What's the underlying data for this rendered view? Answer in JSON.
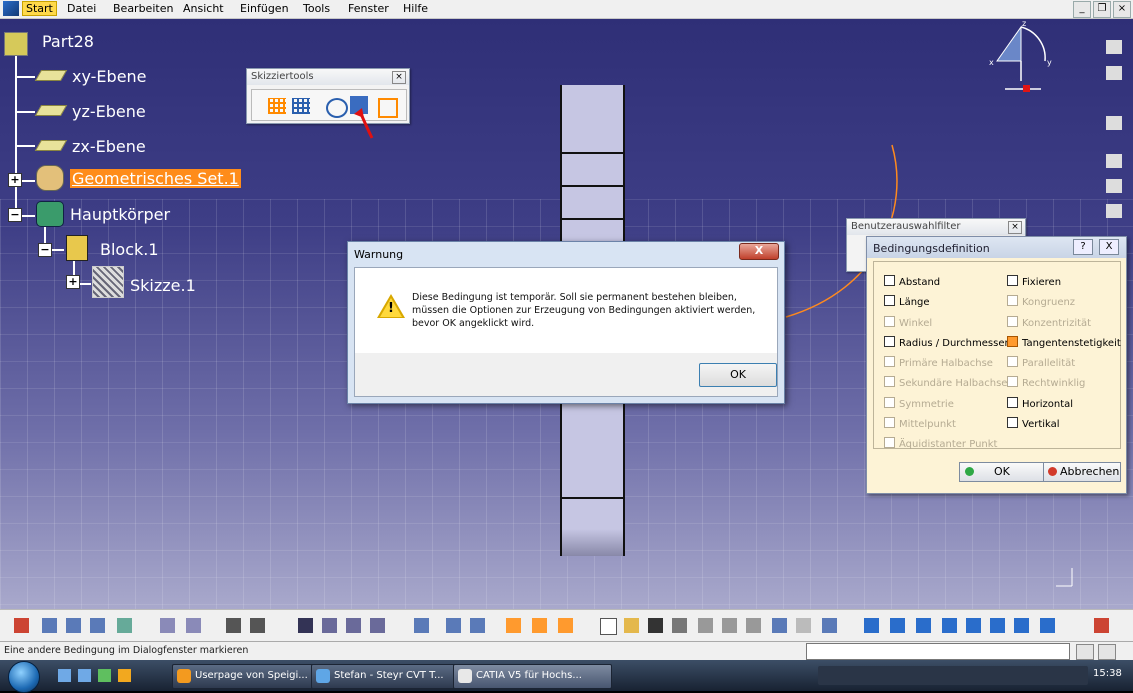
{
  "menubar": {
    "items": [
      "Start",
      "Datei",
      "Bearbeiten",
      "Ansicht",
      "Einfügen",
      "Tools",
      "Fenster",
      "Hilfe"
    ],
    "active": "Start"
  },
  "tree": {
    "root": "Part28",
    "nodes": [
      "xy-Ebene",
      "yz-Ebene",
      "zx-Ebene",
      "Geometrisches Set.1",
      "Hauptkörper",
      "Block.1",
      "Skizze.1"
    ]
  },
  "skizziertools": {
    "title": "Skizziertools"
  },
  "benutzerfilter": {
    "title": "Benutzerauswahlfilter"
  },
  "warning": {
    "title": "Warnung",
    "close": "X",
    "message_lines": [
      "Diese Bedingung ist temporär. Soll sie permanent bestehen bleiben,",
      "müssen die Optionen zur Erzeugung von Bedingungen aktiviert werden,",
      "bevor OK angeklickt wird."
    ],
    "ok": "OK"
  },
  "bedingungsdefinition": {
    "title": "Bedingungsdefinition",
    "help": "?",
    "close": "X",
    "left": [
      {
        "label": "Abstand",
        "enabled": true,
        "checked": false
      },
      {
        "label": "Länge",
        "enabled": true,
        "checked": false
      },
      {
        "label": "Winkel",
        "enabled": false,
        "checked": false
      },
      {
        "label": "Radius / Durchmesser",
        "enabled": true,
        "checked": false
      },
      {
        "label": "Primäre Halbachse",
        "enabled": false,
        "checked": false
      },
      {
        "label": "Sekundäre Halbachse",
        "enabled": false,
        "checked": false
      },
      {
        "label": "Symmetrie",
        "enabled": false,
        "checked": false
      },
      {
        "label": "Mittelpunkt",
        "enabled": false,
        "checked": false
      },
      {
        "label": "Äquidistanter Punkt",
        "enabled": false,
        "checked": false
      }
    ],
    "right": [
      {
        "label": "Fixieren",
        "enabled": true,
        "checked": false
      },
      {
        "label": "Kongruenz",
        "enabled": false,
        "checked": false
      },
      {
        "label": "Konzentrizität",
        "enabled": false,
        "checked": false
      },
      {
        "label": "Tangentenstetigkeit",
        "enabled": true,
        "checked": true
      },
      {
        "label": "Parallelität",
        "enabled": false,
        "checked": false
      },
      {
        "label": "Rechtwinklig",
        "enabled": false,
        "checked": false
      },
      {
        "label": "Horizontal",
        "enabled": true,
        "checked": false
      },
      {
        "label": "Vertikal",
        "enabled": true,
        "checked": false
      }
    ],
    "ok": "OK",
    "cancel": "Abbrechen"
  },
  "status": {
    "text": "Eine andere Bedingung im Dialogfenster markieren"
  },
  "taskbar": {
    "tasks": [
      "Userpage von Speigi...",
      "Stefan - Steyr CVT T...",
      "CATIA V5 für Hochs..."
    ],
    "clock": "15:38"
  },
  "compass": {
    "z_label": "z",
    "x_label": "x",
    "y_label": "y"
  },
  "colors": {
    "tree_highlight": "#ff8c1a",
    "warning_title_bg": "#d8e4f3",
    "dialog_bg": "#fdf3d6"
  }
}
